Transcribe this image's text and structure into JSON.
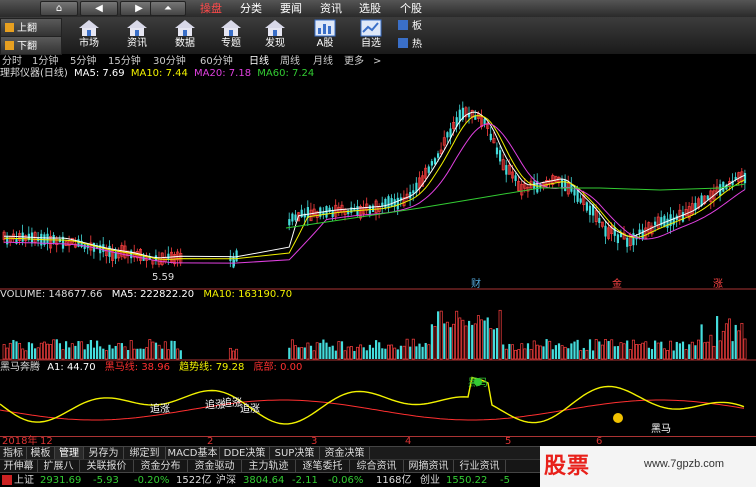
{
  "nav": {
    "tabs": [
      "操盘",
      "分类",
      "要闻",
      "资讯",
      "选股",
      "个股"
    ]
  },
  "toolbar": {
    "page_up": "上翻",
    "page_down": "下翻",
    "buttons": [
      "市场",
      "资讯",
      "数据",
      "专题",
      "发现",
      "A股",
      "自选"
    ],
    "side_buttons": [
      "板",
      "热"
    ]
  },
  "periods": {
    "items": [
      "分时",
      "1分钟",
      "5分钟",
      "15分钟",
      "30分钟",
      "60分钟",
      "日线",
      "周线",
      "月线",
      "更多"
    ],
    "active": "日线"
  },
  "price_panel": {
    "indicator_name": "理邦仪器(日线)",
    "ma5": "MA5: 7.69",
    "ma10": "MA10: 7.44",
    "ma20": "MA20: 7.18",
    "ma60": "MA60: 7.24",
    "low_marker": "5.59",
    "markers": [
      "财",
      "金",
      "涨"
    ],
    "colors": {
      "ma5": "#ffffff",
      "ma10": "#f2f200",
      "ma20": "#e040e0",
      "ma60": "#33cc33",
      "up": "#ff4040",
      "down": "#44dddd"
    }
  },
  "volume_panel": {
    "label": "VOLUME: 148677.66",
    "ma5": "MA5: 222822.20",
    "ma10": "MA10: 163190.70"
  },
  "indicator_panel": {
    "name": "黑马奔腾",
    "a1": "A1: 44.70",
    "heima": "黑马线: 38.96",
    "trend": "趋势线: 79.28",
    "bottom": "底部: 0.00",
    "annotations": [
      "追涨",
      "追涨",
      "追涨",
      "追涨",
      "黑马",
      "黑马"
    ]
  },
  "time_axis": {
    "labels": [
      "2018年",
      "12",
      "2",
      "3",
      "4",
      "5",
      "6"
    ]
  },
  "bottom_tabs": {
    "row1": [
      "指标",
      "模板",
      "管理",
      "另存为",
      "绑定到",
      "MACD基本",
      "DDE决策",
      "SUP决策",
      "资金决策"
    ],
    "row1_active": "管理",
    "row2": [
      "开伸幕",
      "扩展八",
      "关联报价",
      "资金分布",
      "资金驱动",
      "主力轨迹",
      "逐笔委托",
      "综合资讯",
      "网摘资讯",
      "行业资讯"
    ]
  },
  "ticker": {
    "sh_label": "上证",
    "sh_value": "2931.69",
    "sh_change": "-5.93",
    "sh_pct": "-0.20%",
    "sh_amount": "1522亿",
    "sz_label": "沪深",
    "sz_value": "3804.64",
    "sz_change": "-2.11",
    "sz_pct": "-0.06%",
    "sz_amount": "1168亿",
    "cy_label": "创业",
    "cy_value": "1550.22",
    "cy_change": "-5"
  },
  "watermark": {
    "logo": "股票",
    "url": "www.7gpzb.com"
  }
}
